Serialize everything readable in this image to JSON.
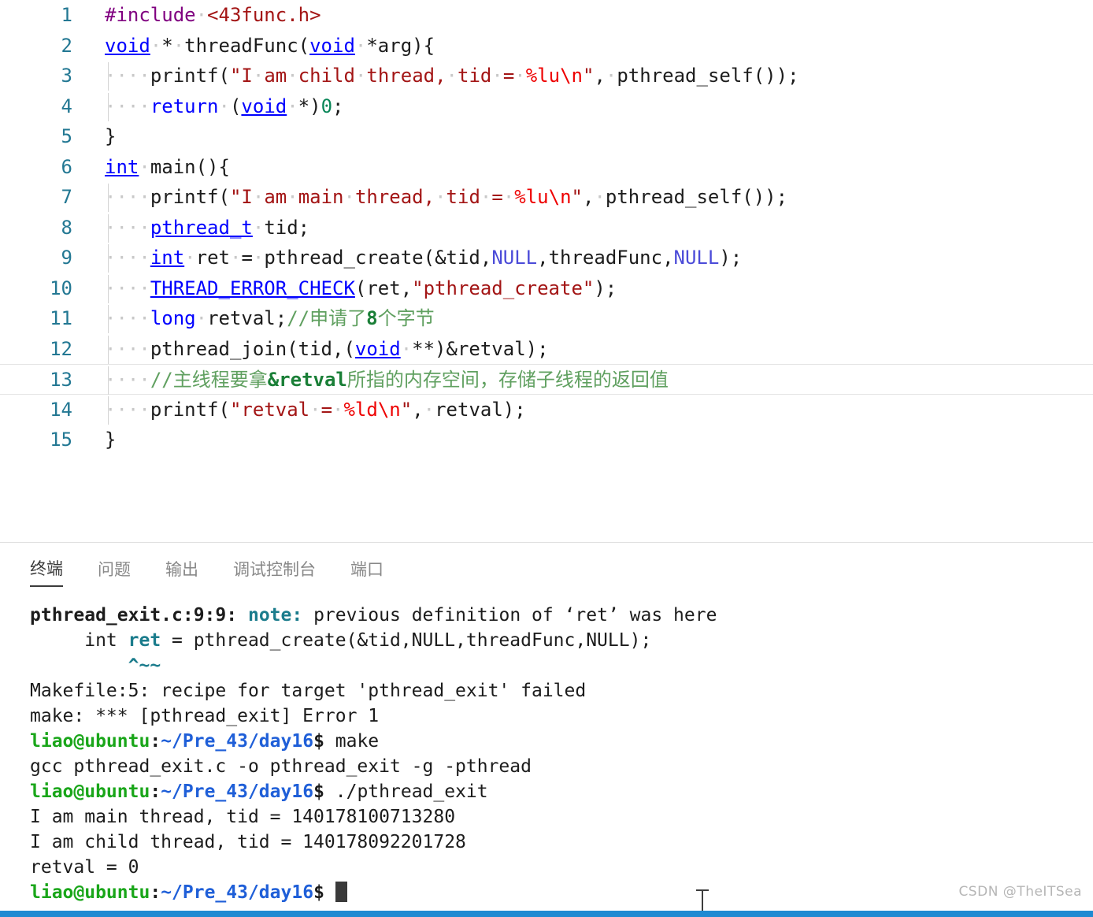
{
  "editor": {
    "language": "c",
    "filename_in_output": "pthread_exit.c",
    "active_line": 13,
    "gutter_color": "#237893",
    "lines": [
      {
        "n": 1,
        "indent": 0,
        "tokens": [
          {
            "t": "#include",
            "c": "t-pp"
          },
          {
            "t": " ",
            "c": "ws-dot"
          },
          {
            "t": "<43func.h>",
            "c": "t-inc"
          }
        ]
      },
      {
        "n": 2,
        "indent": 0,
        "tokens": [
          {
            "t": "void",
            "c": "t-key-u"
          },
          {
            "t": " ",
            "c": "ws-dot"
          },
          {
            "t": "*",
            "c": "t-plain"
          },
          {
            "t": " ",
            "c": "ws-dot"
          },
          {
            "t": "threadFunc(",
            "c": "t-plain"
          },
          {
            "t": "void",
            "c": "t-key-u"
          },
          {
            "t": " ",
            "c": "ws-dot"
          },
          {
            "t": "*arg){",
            "c": "t-plain"
          }
        ]
      },
      {
        "n": 3,
        "indent": 1,
        "tokens": [
          {
            "t": "    ",
            "c": "ws-dots4"
          },
          {
            "t": "printf(",
            "c": "t-plain"
          },
          {
            "t": "\"I am child thread, tid = ",
            "c": "t-str-dots"
          },
          {
            "t": "%lu",
            "c": "t-fmt"
          },
          {
            "t": "\\n",
            "c": "t-fmt"
          },
          {
            "t": "\"",
            "c": "t-str"
          },
          {
            "t": ", ",
            "c": "t-plain-dot"
          },
          {
            "t": "pthread_self());",
            "c": "t-plain"
          }
        ]
      },
      {
        "n": 4,
        "indent": 1,
        "tokens": [
          {
            "t": "    ",
            "c": "ws-dots4"
          },
          {
            "t": "return",
            "c": "t-key"
          },
          {
            "t": " ",
            "c": "ws-dot"
          },
          {
            "t": "(",
            "c": "t-plain"
          },
          {
            "t": "void",
            "c": "t-key-u"
          },
          {
            "t": " ",
            "c": "ws-dot"
          },
          {
            "t": "*)",
            "c": "t-plain"
          },
          {
            "t": "0",
            "c": "t-num"
          },
          {
            "t": ";",
            "c": "t-plain"
          }
        ]
      },
      {
        "n": 5,
        "indent": 0,
        "tokens": [
          {
            "t": "}",
            "c": "t-plain"
          }
        ]
      },
      {
        "n": 6,
        "indent": 0,
        "tokens": [
          {
            "t": "int",
            "c": "t-key-u"
          },
          {
            "t": " ",
            "c": "ws-dot"
          },
          {
            "t": "main(){",
            "c": "t-plain"
          }
        ]
      },
      {
        "n": 7,
        "indent": 1,
        "tokens": [
          {
            "t": "    ",
            "c": "ws-dots4"
          },
          {
            "t": "printf(",
            "c": "t-plain"
          },
          {
            "t": "\"I am main thread, tid = ",
            "c": "t-str-dots"
          },
          {
            "t": "%lu",
            "c": "t-fmt"
          },
          {
            "t": "\\n",
            "c": "t-fmt"
          },
          {
            "t": "\"",
            "c": "t-str"
          },
          {
            "t": ", ",
            "c": "t-plain-dot"
          },
          {
            "t": "pthread_self());",
            "c": "t-plain"
          }
        ]
      },
      {
        "n": 8,
        "indent": 1,
        "tokens": [
          {
            "t": "    ",
            "c": "ws-dots4"
          },
          {
            "t": "pthread_t",
            "c": "t-key-u"
          },
          {
            "t": " ",
            "c": "ws-dot"
          },
          {
            "t": "tid;",
            "c": "t-plain"
          }
        ]
      },
      {
        "n": 9,
        "indent": 1,
        "tokens": [
          {
            "t": "    ",
            "c": "ws-dots4"
          },
          {
            "t": "int",
            "c": "t-key-u"
          },
          {
            "t": " ",
            "c": "ws-dot"
          },
          {
            "t": "ret",
            "c": "t-plain"
          },
          {
            "t": " ",
            "c": "ws-dot"
          },
          {
            "t": "=",
            "c": "t-plain"
          },
          {
            "t": " ",
            "c": "ws-dot"
          },
          {
            "t": "pthread_create(&tid,",
            "c": "t-plain"
          },
          {
            "t": "NULL",
            "c": "t-null"
          },
          {
            "t": ",threadFunc,",
            "c": "t-plain"
          },
          {
            "t": "NULL",
            "c": "t-null"
          },
          {
            "t": ");",
            "c": "t-plain"
          }
        ]
      },
      {
        "n": 10,
        "indent": 1,
        "tokens": [
          {
            "t": "    ",
            "c": "ws-dots4"
          },
          {
            "t": "THREAD_ERROR_CHECK",
            "c": "t-mac"
          },
          {
            "t": "(ret,",
            "c": "t-plain"
          },
          {
            "t": "\"pthread_create\"",
            "c": "t-str"
          },
          {
            "t": ");",
            "c": "t-plain"
          }
        ]
      },
      {
        "n": 11,
        "indent": 1,
        "tokens": [
          {
            "t": "    ",
            "c": "ws-dots4"
          },
          {
            "t": "long",
            "c": "t-key"
          },
          {
            "t": " ",
            "c": "ws-dot"
          },
          {
            "t": "retval;",
            "c": "t-plain"
          },
          {
            "t": "//申请了",
            "c": "t-com"
          },
          {
            "t": "8",
            "c": "t-com-b"
          },
          {
            "t": "个字节",
            "c": "t-com"
          }
        ]
      },
      {
        "n": 12,
        "indent": 1,
        "tokens": [
          {
            "t": "    ",
            "c": "ws-dots4"
          },
          {
            "t": "pthread_join(tid,(",
            "c": "t-plain"
          },
          {
            "t": "void",
            "c": "t-key-u"
          },
          {
            "t": " ",
            "c": "ws-dot"
          },
          {
            "t": "**)&retval);",
            "c": "t-plain"
          }
        ]
      },
      {
        "n": 13,
        "indent": 1,
        "tokens": [
          {
            "t": "    ",
            "c": "ws-dots4"
          },
          {
            "t": "//主线程要拿",
            "c": "t-com"
          },
          {
            "t": "&retval",
            "c": "t-com-b"
          },
          {
            "t": "所指的内存空间，存储子线程的返回值",
            "c": "t-com"
          }
        ]
      },
      {
        "n": 14,
        "indent": 1,
        "tokens": [
          {
            "t": "    ",
            "c": "ws-dots4"
          },
          {
            "t": "printf(",
            "c": "t-plain"
          },
          {
            "t": "\"retval = ",
            "c": "t-str-dots"
          },
          {
            "t": "%ld",
            "c": "t-fmt"
          },
          {
            "t": "\\n",
            "c": "t-fmt"
          },
          {
            "t": "\"",
            "c": "t-str"
          },
          {
            "t": ", ",
            "c": "t-plain-dot"
          },
          {
            "t": "retval);",
            "c": "t-plain"
          }
        ]
      },
      {
        "n": 15,
        "indent": 0,
        "tokens": [
          {
            "t": "}",
            "c": "t-plain"
          }
        ]
      }
    ]
  },
  "panel": {
    "tabs": [
      {
        "label": "终端",
        "active": true
      },
      {
        "label": "问题",
        "active": false
      },
      {
        "label": "输出",
        "active": false
      },
      {
        "label": "调试控制台",
        "active": false
      },
      {
        "label": "端口",
        "active": false
      }
    ],
    "terminal": {
      "prompt_user": "liao@ubuntu",
      "prompt_path": "~/Pre_43/day16",
      "prompt_symbol": "$",
      "lines": [
        {
          "type": "note",
          "file": "pthread_exit.c:9:9:",
          "kw": "note:",
          "rest": " previous definition of ‘ret’ was here"
        },
        {
          "type": "source",
          "pre": "     int ",
          "hl": "ret",
          "post": " = pthread_create(&tid,NULL,threadFunc,NULL);"
        },
        {
          "type": "caret",
          "text": "         ^~~"
        },
        {
          "type": "plain",
          "text": "Makefile:5: recipe for target 'pthread_exit' failed"
        },
        {
          "type": "plain",
          "text": "make: *** [pthread_exit] Error 1"
        },
        {
          "type": "prompt",
          "command": " make"
        },
        {
          "type": "plain",
          "text": "gcc pthread_exit.c -o pthread_exit -g -pthread"
        },
        {
          "type": "prompt",
          "command": " ./pthread_exit"
        },
        {
          "type": "plain",
          "text": "I am main thread, tid = 140178100713280"
        },
        {
          "type": "plain",
          "text": "I am child thread, tid = 140178092201728"
        },
        {
          "type": "plain",
          "text": "retval = 0"
        },
        {
          "type": "prompt-cursor",
          "command": " "
        }
      ]
    }
  },
  "watermark": {
    "text": "CSDN @TheITSea"
  },
  "colors": {
    "keyword": "#0000ff",
    "string": "#a31515",
    "format_specifier": "#ee0000",
    "comment": "#60a060",
    "comment_bold": "#1a7f37",
    "number": "#098658",
    "null_literal": "#4b4bd8",
    "macro": "#0000ff",
    "line_number": "#237893",
    "preprocessor": "#800080",
    "terminal_prompt_user": "#1aa61a",
    "terminal_prompt_path": "#1f5fd8",
    "terminal_note": "#1b7c8c",
    "status_bar": "#1f8ad2",
    "active_line_border": "#e4e4e4"
  }
}
